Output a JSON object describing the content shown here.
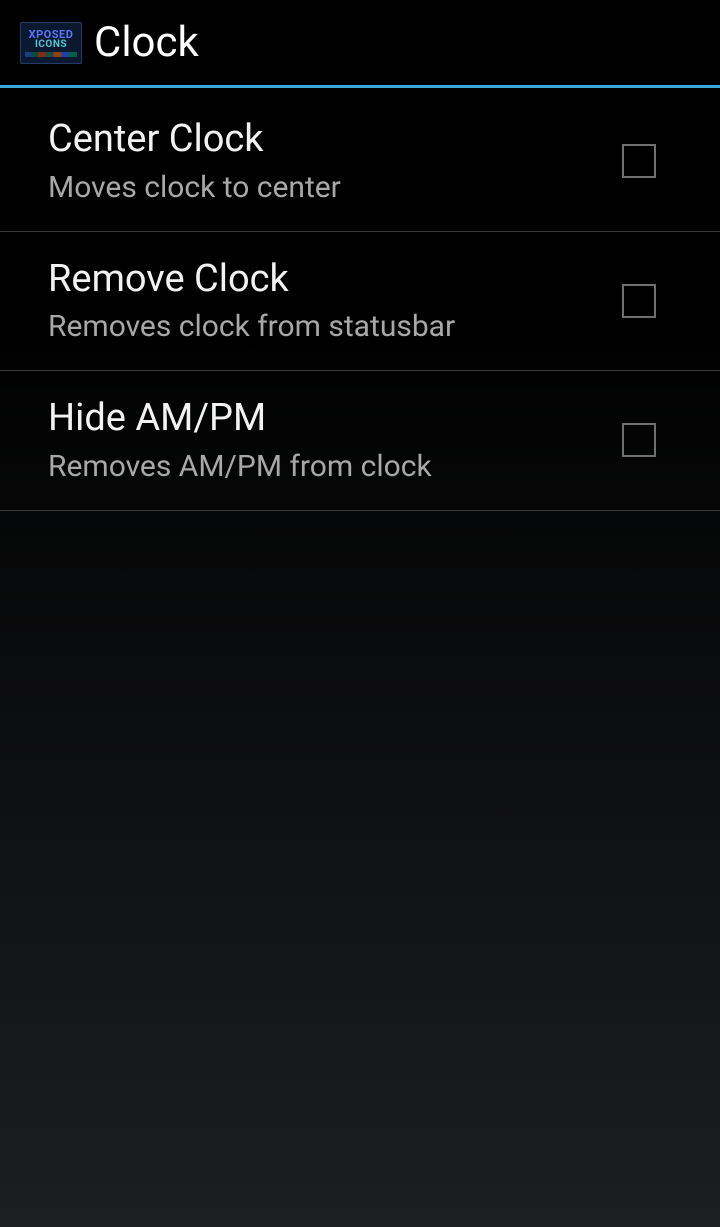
{
  "header": {
    "app_icon_line1": "XPOSED",
    "app_icon_line2": "ICONS",
    "title": "Clock"
  },
  "settings": [
    {
      "title": "Center Clock",
      "summary": "Moves clock to center",
      "checked": false
    },
    {
      "title": "Remove Clock",
      "summary": "Removes clock from statusbar",
      "checked": false
    },
    {
      "title": "Hide AM/PM",
      "summary": "Removes AM/PM from clock",
      "checked": false
    }
  ]
}
